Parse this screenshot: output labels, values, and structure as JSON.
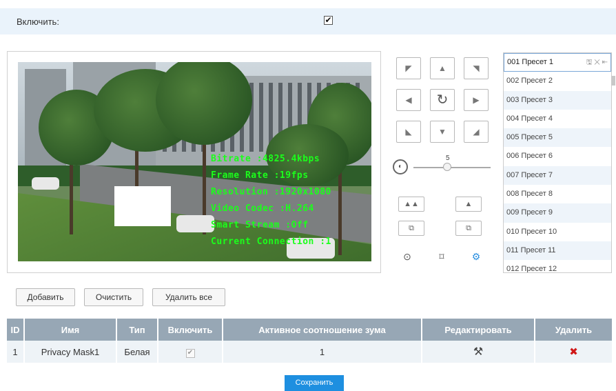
{
  "enable": {
    "label": "Включить:",
    "checked": true,
    "check_glyph": "✔"
  },
  "video": {
    "osd_lines": [
      "Bitrate :4825.4kbps",
      "Frame Rate :19fps",
      "Resolution :1920x1080",
      "Video Codec :H.264",
      "Smart Stream :Off",
      "Current Connection :1"
    ],
    "osd_color": "#1bff1b"
  },
  "ptz": {
    "arrows": {
      "up_left": "◤",
      "up": "▲",
      "up_right": "◥",
      "left": "◀",
      "refresh": "↻",
      "right": "▶",
      "down_left": "◣",
      "down": "▼",
      "down_right": "◢"
    },
    "speed_label": "5",
    "speed_value": 5,
    "zoom_in": "▲▲",
    "zoom_out": "▲",
    "focus_near": "⧉",
    "focus_far": "⧉",
    "iris_icon": "⊙",
    "focus_icon": "⌑",
    "settings_icon": "⚙"
  },
  "presets": {
    "items": [
      "001 Пресет 1",
      "002 Пресет 2",
      "003 Пресет 3",
      "004 Пресет 4",
      "005 Пресет 5",
      "006 Пресет 6",
      "007 Пресет 7",
      "008 Пресет 8",
      "009 Пресет 9",
      "010 Пресет 10",
      "011 Пресет 11",
      "012 Пресет 12"
    ],
    "selected_index": 0,
    "tools": "🖫 ✕ ⇤"
  },
  "actions": {
    "add": "Добавить",
    "clear": "Очистить",
    "delete_all": "Удалить все"
  },
  "table": {
    "headers": [
      "ID",
      "Имя",
      "Тип",
      "Включить",
      "Активное соотношение зума",
      "Редактировать",
      "Удалить"
    ],
    "rows": [
      {
        "id": "1",
        "name": "Privacy Mask1",
        "type": "Белая",
        "enabled": "✔",
        "zoom": "1",
        "edit_icon": "⚒",
        "delete_icon": "✖"
      }
    ]
  },
  "save": {
    "label": "Сохранить"
  },
  "colors": {
    "accent": "#1e8fe0",
    "header_bg": "#97a7b5",
    "row_bg": "#eef3f7",
    "delete": "#d01818"
  }
}
